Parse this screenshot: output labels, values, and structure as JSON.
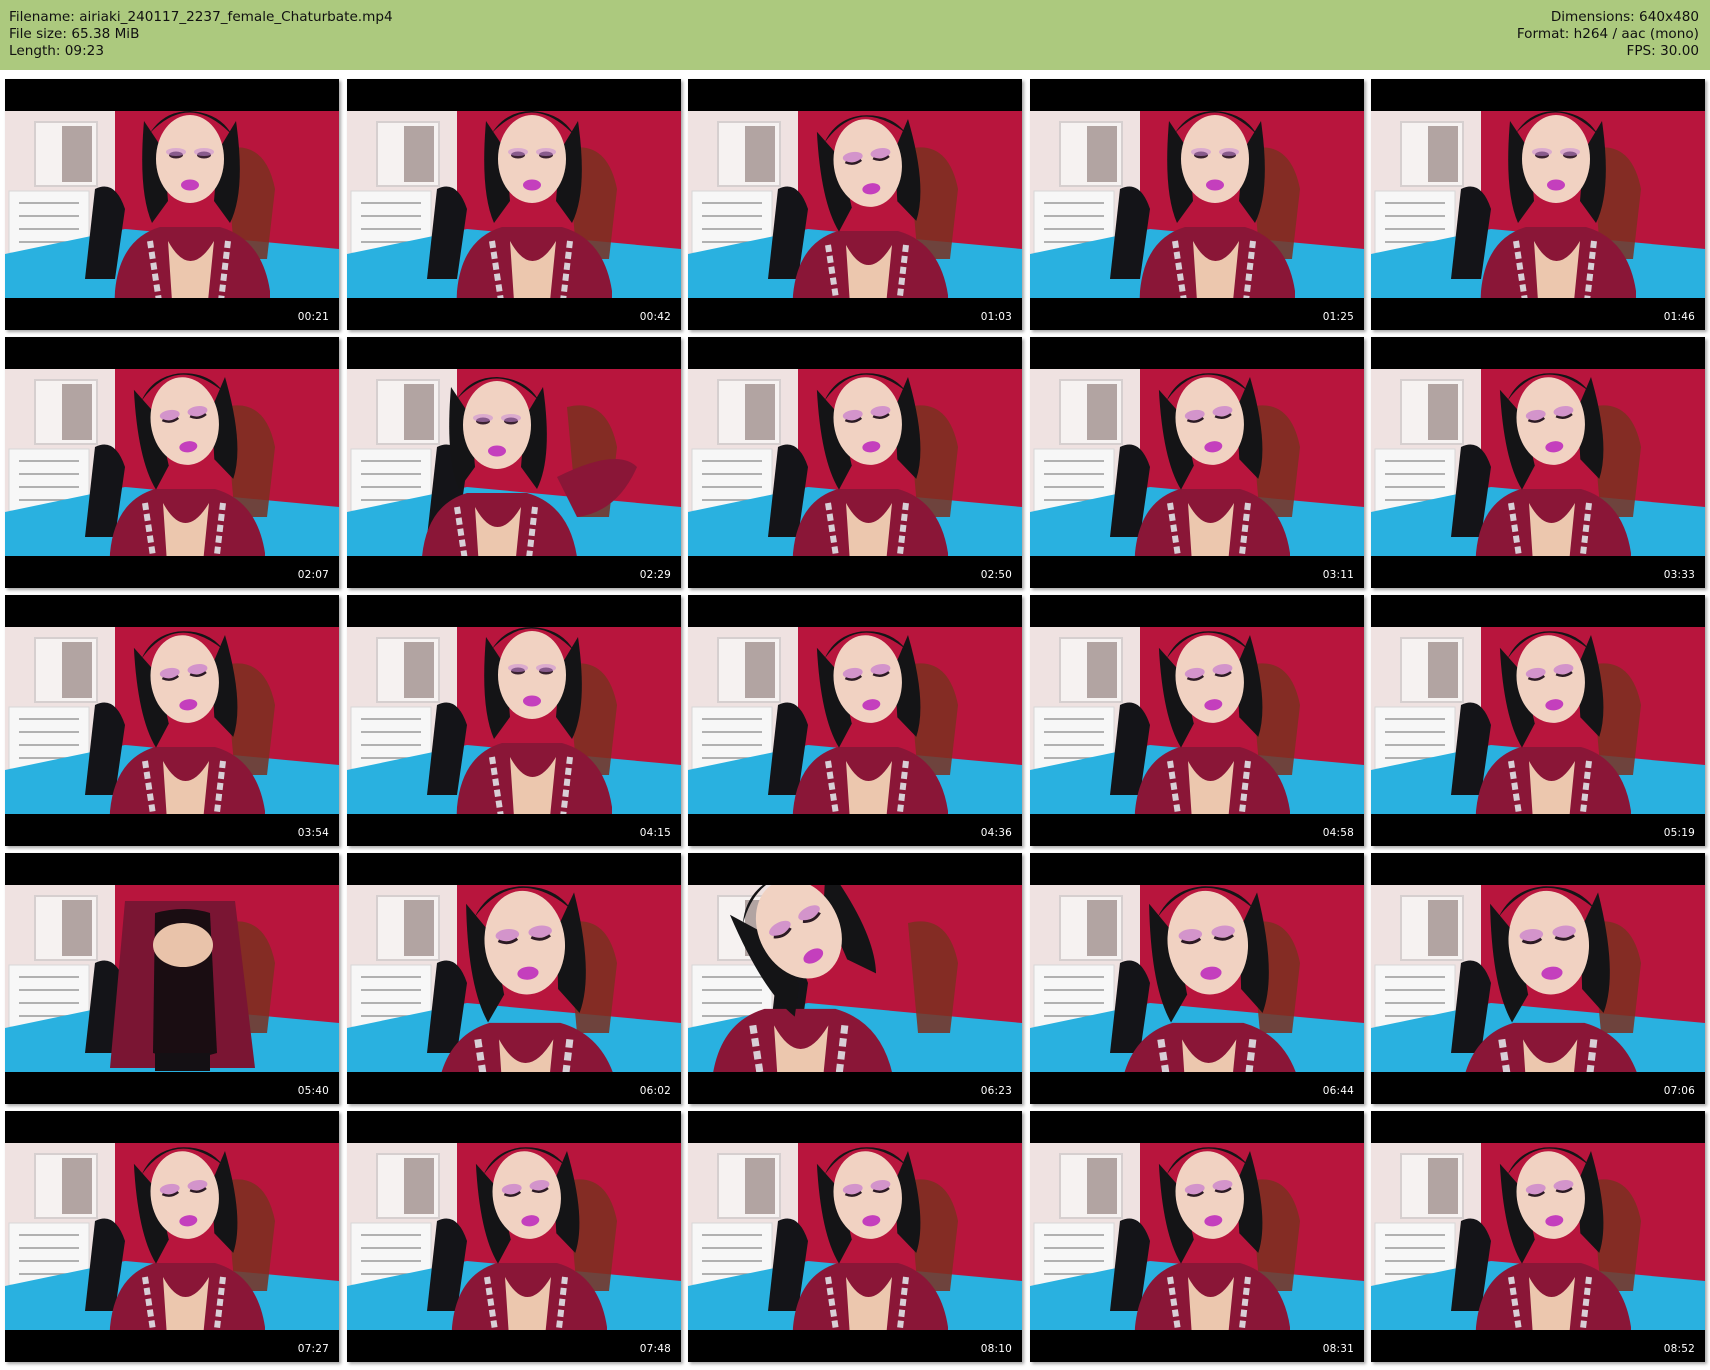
{
  "header": {
    "filename": "Filename: airiaki_240117_2237_female_Chaturbate.mp4",
    "file_size": "File size: 65.38 MiB",
    "length": "Length: 09:23",
    "dimensions": "Dimensions: 640x480",
    "format": "Format: h264 / aac (mono)",
    "fps": "FPS: 30.00"
  },
  "thumbnails": [
    {
      "time": "00:21",
      "pose": "front"
    },
    {
      "time": "00:42",
      "pose": "front"
    },
    {
      "time": "01:03",
      "pose": "down"
    },
    {
      "time": "01:25",
      "pose": "front"
    },
    {
      "time": "01:46",
      "pose": "front"
    },
    {
      "time": "02:07",
      "pose": "down"
    },
    {
      "time": "02:29",
      "pose": "arm"
    },
    {
      "time": "02:50",
      "pose": "down"
    },
    {
      "time": "03:11",
      "pose": "down"
    },
    {
      "time": "03:33",
      "pose": "down"
    },
    {
      "time": "03:54",
      "pose": "down"
    },
    {
      "time": "04:15",
      "pose": "front"
    },
    {
      "time": "04:36",
      "pose": "down"
    },
    {
      "time": "04:58",
      "pose": "down"
    },
    {
      "time": "05:19",
      "pose": "down"
    },
    {
      "time": "05:40",
      "pose": "standing"
    },
    {
      "time": "06:02",
      "pose": "close"
    },
    {
      "time": "06:23",
      "pose": "tilt"
    },
    {
      "time": "06:44",
      "pose": "close"
    },
    {
      "time": "07:06",
      "pose": "close"
    },
    {
      "time": "07:27",
      "pose": "down"
    },
    {
      "time": "07:48",
      "pose": "down"
    },
    {
      "time": "08:10",
      "pose": "down"
    },
    {
      "time": "08:31",
      "pose": "down"
    },
    {
      "time": "08:52",
      "pose": "down"
    }
  ]
}
